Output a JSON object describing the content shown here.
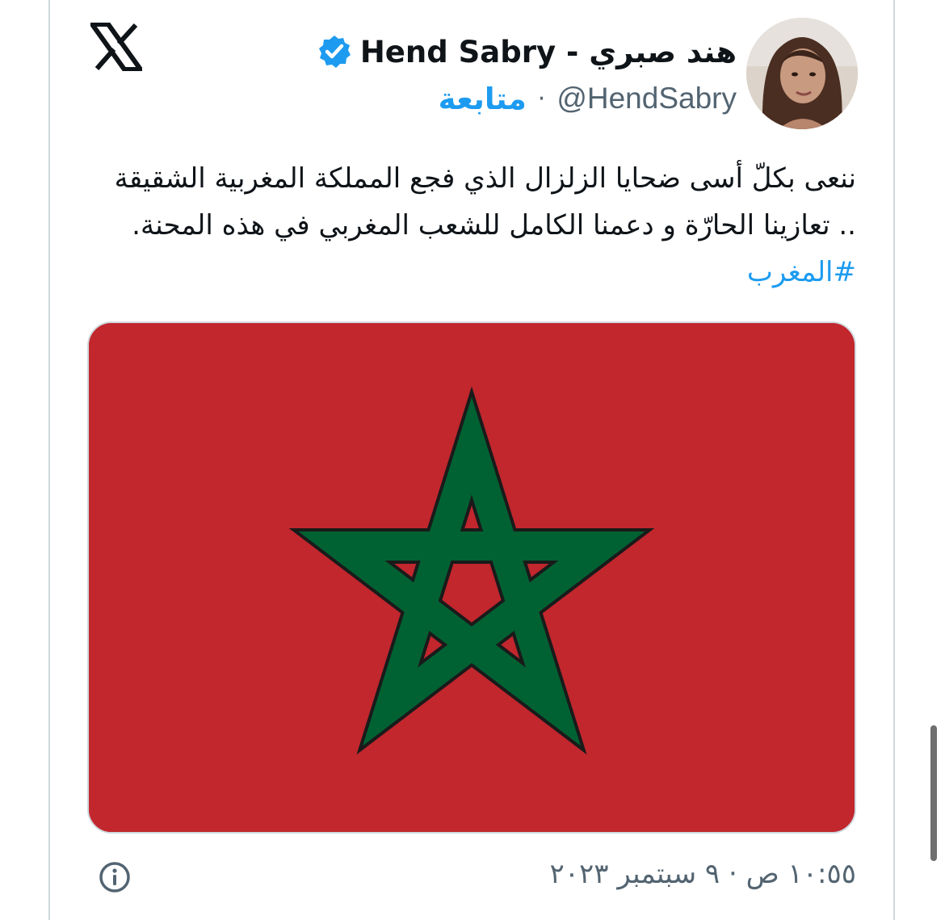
{
  "author": {
    "display_name": "هند صبري - Hend Sabry",
    "handle": "@HendSabry",
    "separator": "·",
    "follow_label": "متابعة",
    "verified": true
  },
  "tweet": {
    "lines": [
      "ننعى بكلّ أسى ضحايا الزلزال الذي فجع المملكة المغربية الشقيقة",
      ".. تعازينا الحارّة و دعمنا الكامل للشعب المغربي في هذه المحنة."
    ],
    "hashtag": "#المغرب"
  },
  "media": {
    "description_icon": "morocco-flag",
    "flag_colors": {
      "field": "#c1272d",
      "star": "#006233"
    }
  },
  "footer": {
    "timestamp": "١٠:٥٥ ص · ٩ سبتمبر ٢٠٢٣"
  },
  "icons": {
    "brand": "x-logo-icon",
    "verified": "verified-badge-icon",
    "info": "info-icon"
  },
  "colors": {
    "accent": "#1d9bf0",
    "text_primary": "#0f1419",
    "text_secondary": "#536471",
    "border": "#cfd9de"
  }
}
